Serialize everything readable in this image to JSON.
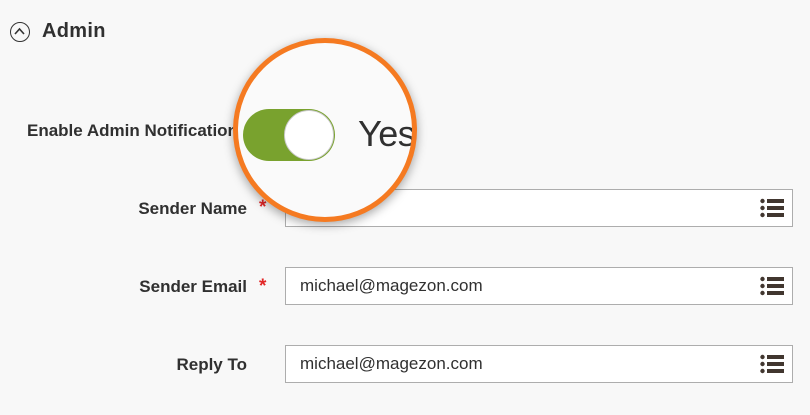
{
  "section": {
    "title": "Admin",
    "icon": "collapse-up-icon"
  },
  "enable_notifications": {
    "label": "Enable Admin Notification",
    "state": "Yes",
    "enabled": true,
    "accent": "#79a22e"
  },
  "sender_name": {
    "label": "Sender Name",
    "required": "*",
    "value": "",
    "icon": "list-icon"
  },
  "sender_email": {
    "label": "Sender Email",
    "required": "*",
    "value": "michael@magezon.com",
    "icon": "list-icon"
  },
  "reply_to": {
    "label": "Reply To",
    "value": "michael@magezon.com",
    "icon": "list-icon"
  },
  "highlight_color": "#f57a21"
}
